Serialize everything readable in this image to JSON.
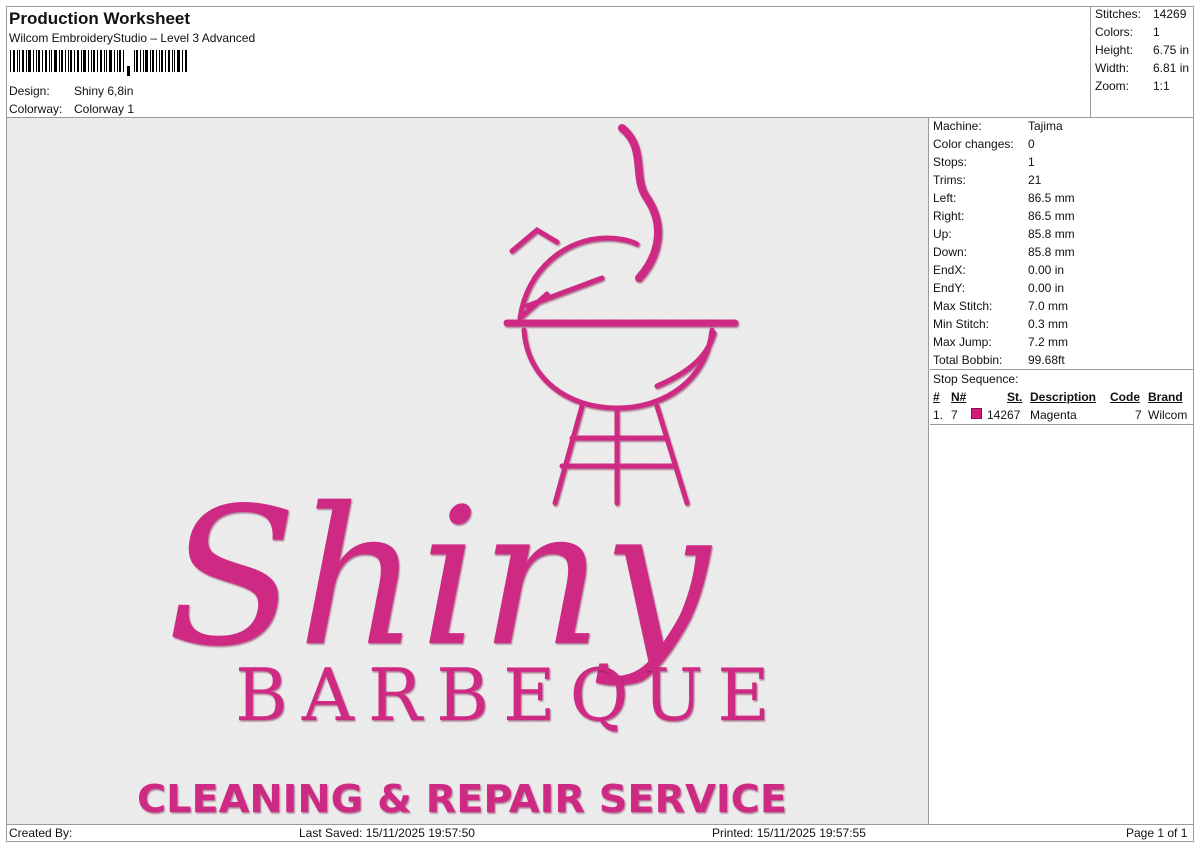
{
  "header": {
    "title": "Production Worksheet",
    "subtitle": "Wilcom EmbroideryStudio – Level 3 Advanced",
    "design_label": "Design:",
    "design_value": "Shiny 6,8in",
    "colorway_label": "Colorway:",
    "colorway_value": "Colorway 1"
  },
  "stats": [
    {
      "label": "Stitches:",
      "value": "14269"
    },
    {
      "label": "Colors:",
      "value": "1"
    },
    {
      "label": "Height:",
      "value": "6.75 in"
    },
    {
      "label": "Width:",
      "value": "6.81 in"
    },
    {
      "label": "Zoom:",
      "value": "1:1"
    }
  ],
  "machine_info": [
    {
      "label": "Machine:",
      "value": "Tajima"
    },
    {
      "label": "Color changes:",
      "value": "0"
    },
    {
      "label": "Stops:",
      "value": "1"
    },
    {
      "label": "Trims:",
      "value": "21"
    },
    {
      "label": "Left:",
      "value": "86.5 mm"
    },
    {
      "label": "Right:",
      "value": "86.5 mm"
    },
    {
      "label": "Up:",
      "value": "85.8 mm"
    },
    {
      "label": "Down:",
      "value": "85.8 mm"
    },
    {
      "label": "EndX:",
      "value": "0.00 in"
    },
    {
      "label": "EndY:",
      "value": "0.00 in"
    },
    {
      "label": "Max Stitch:",
      "value": "7.0 mm"
    },
    {
      "label": "Min Stitch:",
      "value": "0.3 mm"
    },
    {
      "label": "Max Jump:",
      "value": "7.2 mm"
    },
    {
      "label": "Total Bobbin:",
      "value": "99.68ft"
    }
  ],
  "stop_sequence": {
    "title": "Stop Sequence:",
    "headers": {
      "num": "#",
      "n": "N#",
      "st": "St.",
      "description": "Description",
      "code": "Code",
      "brand": "Brand"
    },
    "rows": [
      {
        "num": "1.",
        "n": "7",
        "color": "#d51b7a",
        "st": "14267",
        "description": "Magenta",
        "code": "7",
        "brand": "Wilcom"
      }
    ]
  },
  "design_art": {
    "script_word": "Shiny",
    "word2": "BARBEQUE",
    "tagline": "CLEANING & REPAIR SERVICE",
    "thread_color": "#cf2b83",
    "thread_shadow": "#9c1d60",
    "icon": "grill-icon"
  },
  "footer": {
    "created_by": "Created By:",
    "last_saved": "Last Saved: 15/11/2025 19:57:50",
    "printed": "Printed: 15/11/2025 19:57:55",
    "page": "Page 1 of 1"
  }
}
